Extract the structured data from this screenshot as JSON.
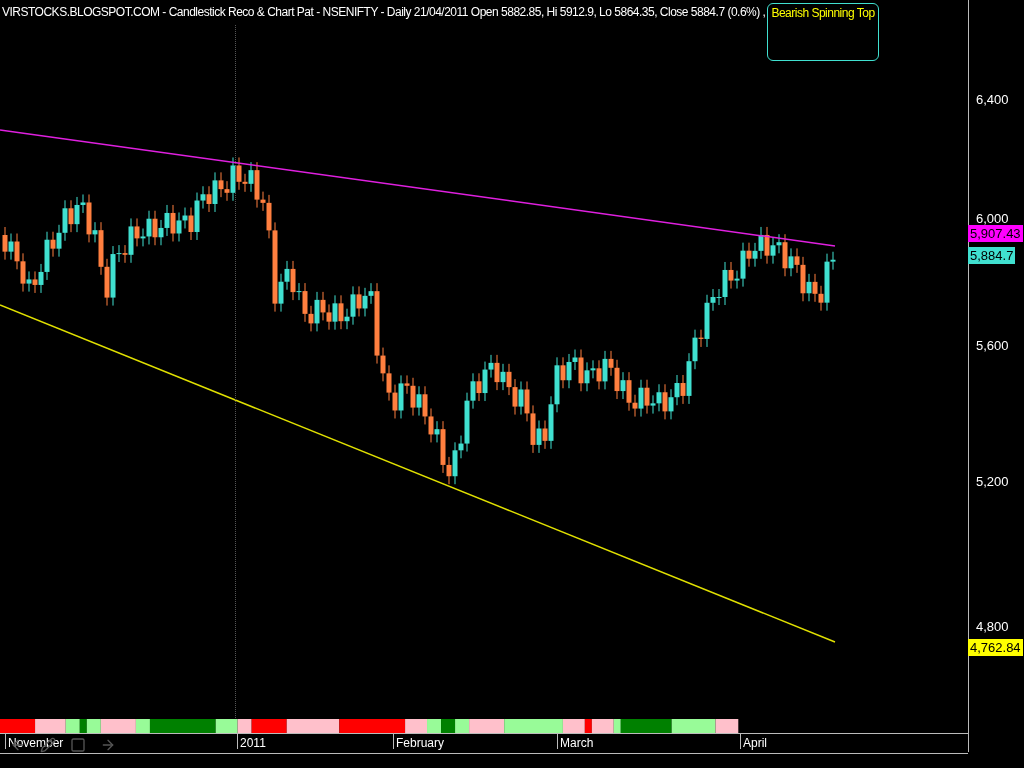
{
  "title": {
    "text": "VIRSTOCKS.BLOGSPOT.COM - Candlestick Reco & Chart Pat - NSENIFTY - Daily 21/04/2011 Open 5882.85, Hi 5912.9, Lo 5864.35, Close 5884.7 (0.6%) ,",
    "pattern": "Bearish Spinning Top"
  },
  "price_axis": {
    "ticks": [
      "6,400",
      "6,000",
      "5,600",
      "5,200",
      "4,800"
    ],
    "badges": [
      {
        "text": "5,907.43",
        "color": "#ff00ff"
      },
      {
        "text": "5,884.7",
        "color": "#40e0d0"
      },
      {
        "text": "4,762.84",
        "color": "#ffff00"
      }
    ]
  },
  "date_axis": {
    "labels": [
      "November",
      "2011",
      "February",
      "March",
      "April"
    ]
  }
}
